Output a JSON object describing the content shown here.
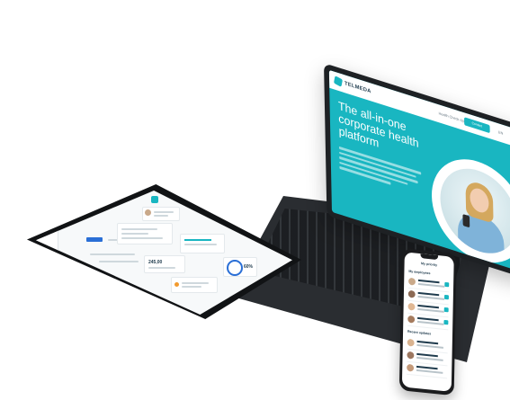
{
  "laptop": {
    "brand": "TELMEDA",
    "nav_link": "Health Check-Ups",
    "cta_label": "Contact",
    "lang": "EN",
    "headline": "The all-in-one corporate health platform",
    "accent_color": "#19b6c1",
    "hero_icon": "woman-with-phone-photo"
  },
  "tablet": {
    "metric_value": "245,00",
    "progress_label": "60%"
  },
  "phone": {
    "title": "My priority",
    "section_one": "My employees",
    "section_two": "Recent updates",
    "avatar_icon": "user-avatar-icon"
  },
  "colors": {
    "brand_teal": "#19b6c1",
    "dark_frame": "#1e2124",
    "primary_blue": "#2a6fd6"
  }
}
